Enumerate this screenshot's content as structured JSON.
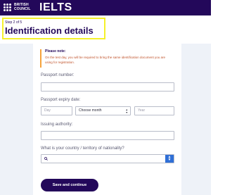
{
  "header": {
    "brand_line1": "BRITISH",
    "brand_line2": "COUNCIL",
    "product": "IELTS"
  },
  "step": {
    "label": "Step 2 of 5",
    "title": "Identification details"
  },
  "note": {
    "title": "Please note:",
    "text": "On the test day, you will be required to bring the same identification document you are using for registration."
  },
  "form": {
    "passport_number": {
      "label": "Passport number:",
      "value": ""
    },
    "expiry": {
      "label": "Passport expiry date:",
      "day_placeholder": "Day",
      "month_value": "Choose month",
      "year_placeholder": "Year"
    },
    "issuing_authority": {
      "label": "Issuing authority:",
      "value": ""
    },
    "nationality": {
      "label": "What is your country / territory of nationality?",
      "value": ""
    }
  },
  "actions": {
    "submit_label": "Save and continue"
  },
  "colors": {
    "brand": "#23085a",
    "highlight": "#f5f12a",
    "note_accent": "#f6a23b",
    "search_button": "#2f6fd6",
    "form_background": "#eef2f8"
  }
}
